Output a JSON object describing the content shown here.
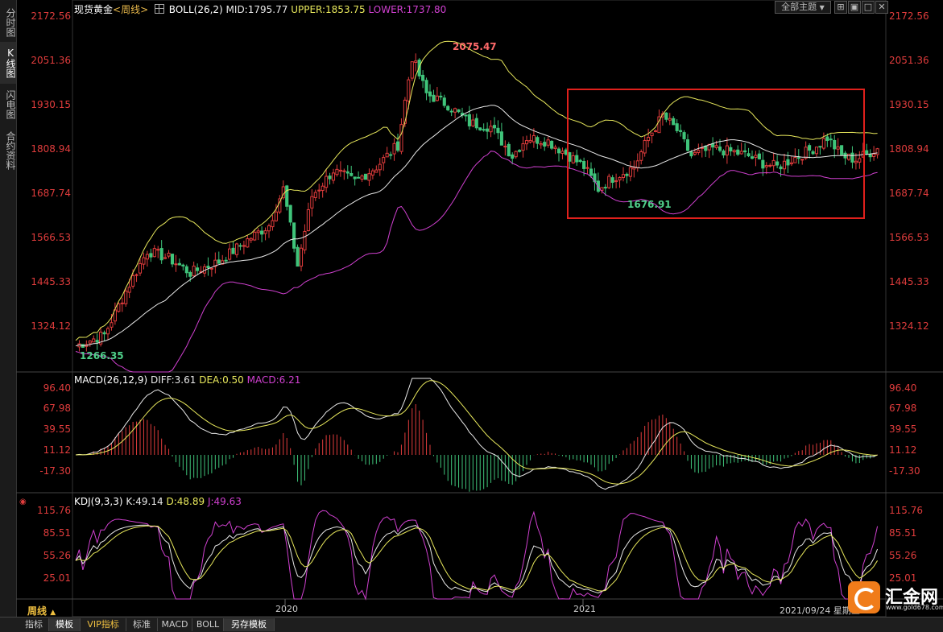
{
  "main_header": {
    "instrument": "现货黄金",
    "period": "<周线>",
    "indicator_icon": "grid-icon",
    "boll": "BOLL(26,2)",
    "mid": "MID:1795.77",
    "upper": "UPPER:1853.75",
    "lower": "LOWER:1737.80"
  },
  "toolbar": {
    "theme_select": "全部主题",
    "theme_arrow": "▼"
  },
  "sidebar": {
    "tabs": [
      "分时图",
      "K线图",
      "闪电图",
      "合约资料"
    ]
  },
  "price_axis": [
    "2172.56",
    "2051.36",
    "1930.15",
    "1808.94",
    "1687.74",
    "1566.53",
    "1445.33",
    "1324.12"
  ],
  "annotations": {
    "high": "2075.47",
    "low_recent": "1676.91",
    "low_start": "1266.35"
  },
  "macd_header": {
    "name": "MACD(26,12,9)",
    "diff": "DIFF:3.61",
    "dea": "DEA:0.50",
    "macd": "MACD:6.21"
  },
  "macd_axis": [
    "96.40",
    "67.98",
    "39.55",
    "11.12",
    "-17.30"
  ],
  "kdj_header": {
    "name": "KDJ(9,3,3)",
    "k": "K:49.14",
    "d": "D:48.89",
    "j": "J:49.63"
  },
  "kdj_axis": [
    "115.76",
    "85.51",
    "55.26",
    "25.01"
  ],
  "x_axis": [
    "2020",
    "2021"
  ],
  "period_label": "周线",
  "period_arrow": "▲",
  "date_label": "2021/09/24 星期五",
  "bottom_tabs": [
    "指标",
    "模板",
    "VIP指标",
    "标准",
    "MACD",
    "BOLL",
    "另存模板"
  ],
  "logo": {
    "text": "汇金网",
    "url": "www.gold678.com"
  },
  "colors": {
    "up": "#e03c3c",
    "down": "#3fc47a",
    "mid": "#e8e8e8",
    "upper": "#e8e85c",
    "lower": "#d040d0",
    "highlight_box": "#e0201c"
  }
}
